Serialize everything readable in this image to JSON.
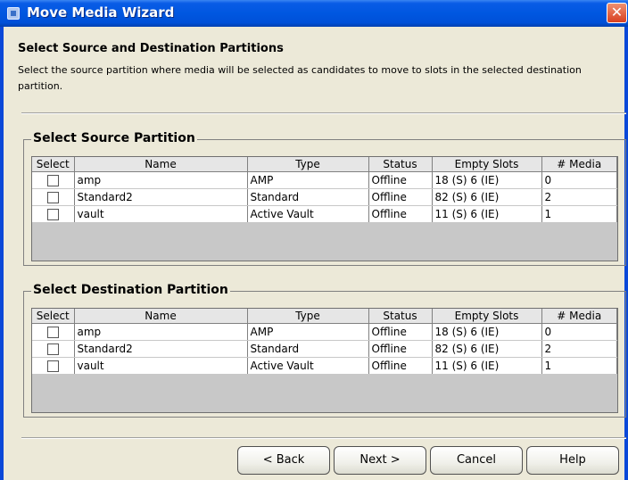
{
  "window": {
    "title": "Move Media Wizard",
    "close_glyph": "✕"
  },
  "heading": "Select Source and Destination Partitions",
  "description": "Select the source partition where media will be selected as candidates to move to slots in the selected destination partition.",
  "columns": [
    "Select",
    "Name",
    "Type",
    "Status",
    "Empty Slots",
    "# Media"
  ],
  "source": {
    "title": "Select Source Partition",
    "rows": [
      {
        "name": "amp",
        "type": "AMP",
        "status": "Offline",
        "empty_slots": "18 (S) 6 (IE)",
        "media": "0",
        "checked": false
      },
      {
        "name": "Standard2",
        "type": "Standard",
        "status": "Offline",
        "empty_slots": "82 (S) 6 (IE)",
        "media": "2",
        "checked": false
      },
      {
        "name": "vault",
        "type": "Active Vault",
        "status": "Offline",
        "empty_slots": "11 (S) 6 (IE)",
        "media": "1",
        "checked": false
      }
    ]
  },
  "destination": {
    "title": "Select Destination Partition",
    "rows": [
      {
        "name": "amp",
        "type": "AMP",
        "status": "Offline",
        "empty_slots": "18 (S) 6 (IE)",
        "media": "0",
        "checked": false
      },
      {
        "name": "Standard2",
        "type": "Standard",
        "status": "Offline",
        "empty_slots": "82 (S) 6 (IE)",
        "media": "2",
        "checked": false
      },
      {
        "name": "vault",
        "type": "Active Vault",
        "status": "Offline",
        "empty_slots": "11 (S) 6 (IE)",
        "media": "1",
        "checked": false
      }
    ]
  },
  "buttons": {
    "back": "< Back",
    "next": "Next >",
    "cancel": "Cancel",
    "help": "Help"
  }
}
